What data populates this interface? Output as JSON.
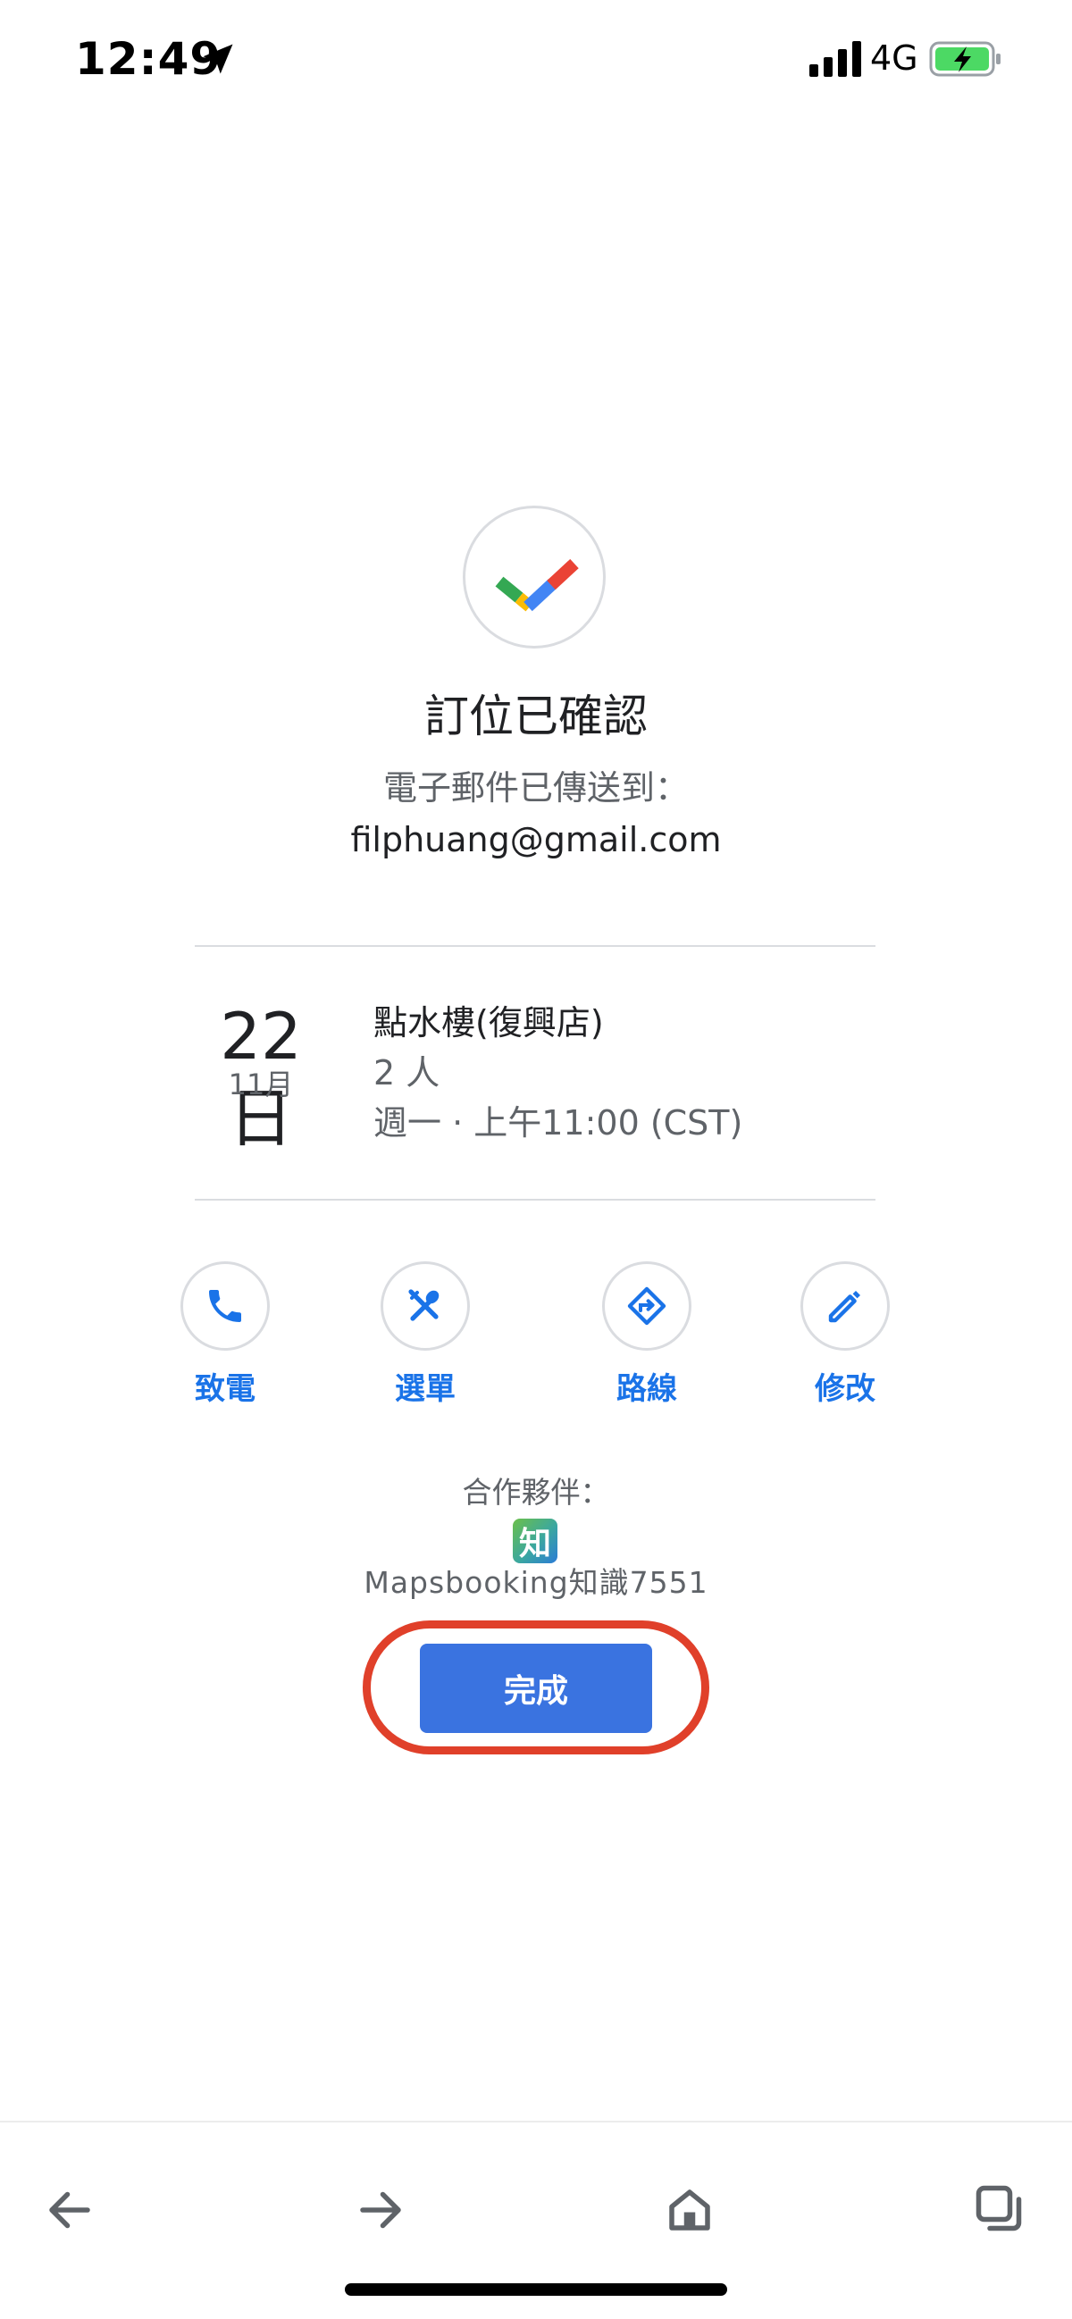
{
  "status_bar": {
    "time": "12:49",
    "network": "4G",
    "battery_color": "#4cd964"
  },
  "confirmation": {
    "title": "訂位已確認",
    "email_sent_label": "電子郵件已傳送到：",
    "email": "filphuang@gmail.com"
  },
  "reservation": {
    "day": "22日",
    "month": "11月",
    "restaurant": "點水樓(復興店)",
    "party_size": "2 人",
    "datetime": "週一 · 上午11:00 (CST)"
  },
  "actions": [
    {
      "label": "致電",
      "icon": "phone-icon"
    },
    {
      "label": "選單",
      "icon": "utensils-icon"
    },
    {
      "label": "路線",
      "icon": "directions-icon"
    },
    {
      "label": "修改",
      "icon": "edit-pencil-icon"
    }
  ],
  "partner": {
    "label": "合作夥伴：",
    "logo_text": "知",
    "name": "Mapsbooking知識7551"
  },
  "done_button": {
    "label": "完成",
    "color": "#3a73e0",
    "highlight_color": "#e0402a"
  },
  "colors": {
    "accent": "#1a73e8",
    "text_primary": "#202124",
    "text_secondary": "#5f6368",
    "divider": "#dadce0"
  }
}
